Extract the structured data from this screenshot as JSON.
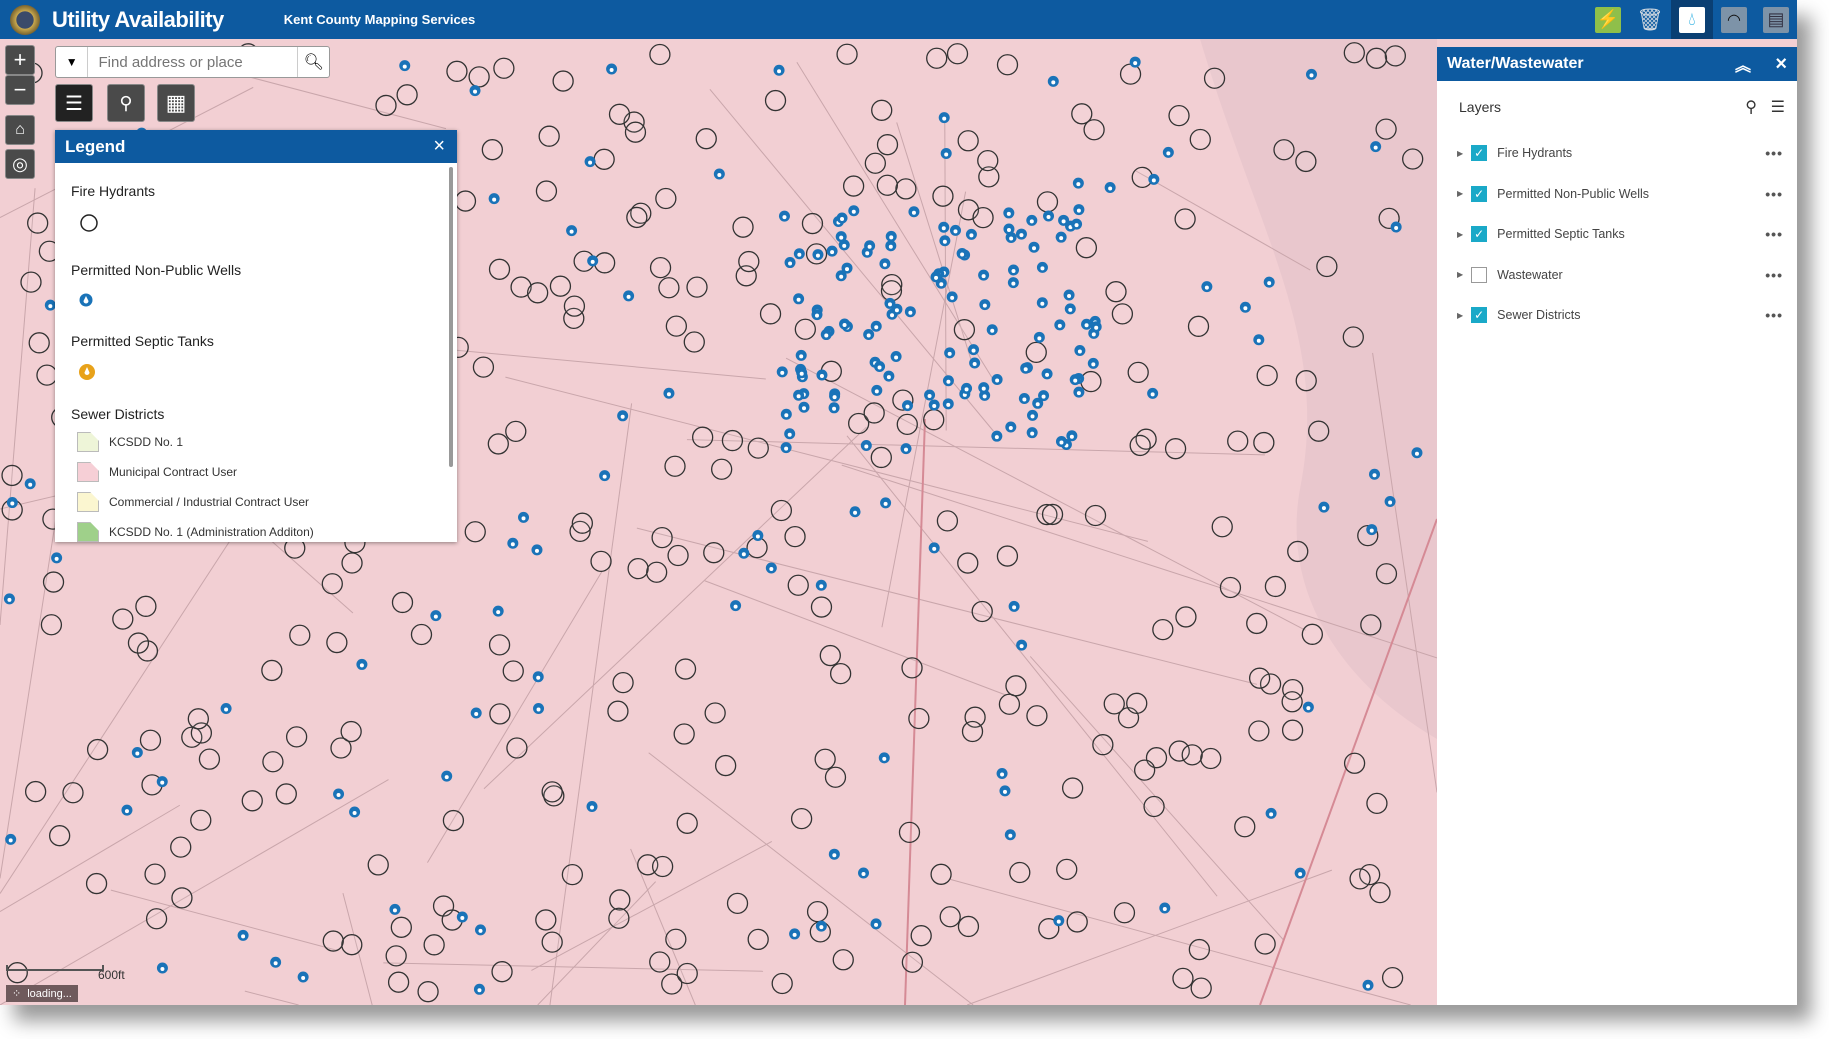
{
  "header": {
    "title": "Utility Availability",
    "subtitle": "Kent County Mapping Services",
    "widgets": [
      {
        "name": "electric",
        "icon": "lightning-icon",
        "color": "#8fbf4a"
      },
      {
        "name": "trash",
        "icon": "trash-icon",
        "color": "#d0d8e0"
      },
      {
        "name": "water",
        "icon": "water-drop-icon",
        "color": "#ffffff",
        "active": true
      },
      {
        "name": "wireless",
        "icon": "wifi-icon",
        "color": "#7d93a8"
      },
      {
        "name": "map",
        "icon": "map-icon",
        "color": "#7d93a8"
      }
    ]
  },
  "search": {
    "placeholder": "Find address or place"
  },
  "legend": {
    "title": "Legend",
    "close": "×",
    "sections": {
      "hydrants": "Fire Hydrants",
      "wells": "Permitted Non-Public Wells",
      "septic": "Permitted Septic Tanks",
      "sewer": "Sewer Districts"
    },
    "districts": [
      {
        "label": "KCSDD No. 1",
        "color": "#eef5d8"
      },
      {
        "label": "Municipal Contract User",
        "color": "#f6cfd6"
      },
      {
        "label": "Commercial / Industrial Contract User",
        "color": "#fbf6d0"
      },
      {
        "label": "KCSDD No. 1 (Administration Additon)",
        "color": "#9fd08a"
      }
    ]
  },
  "panel": {
    "title": "Water/Wastewater",
    "collapse": "︽",
    "close": "×",
    "layers_label": "Layers",
    "layers": [
      {
        "label": "Fire Hydrants",
        "checked": true
      },
      {
        "label": "Permitted Non-Public Wells",
        "checked": true
      },
      {
        "label": "Permitted Septic Tanks",
        "checked": true
      },
      {
        "label": "Wastewater",
        "checked": false
      },
      {
        "label": "Sewer Districts",
        "checked": true
      }
    ]
  },
  "map": {
    "scale": "600ft",
    "status": "loading...",
    "fill": "#f2cfd3",
    "hydrant_color": "#333333",
    "well_color": "#1a73b8"
  }
}
